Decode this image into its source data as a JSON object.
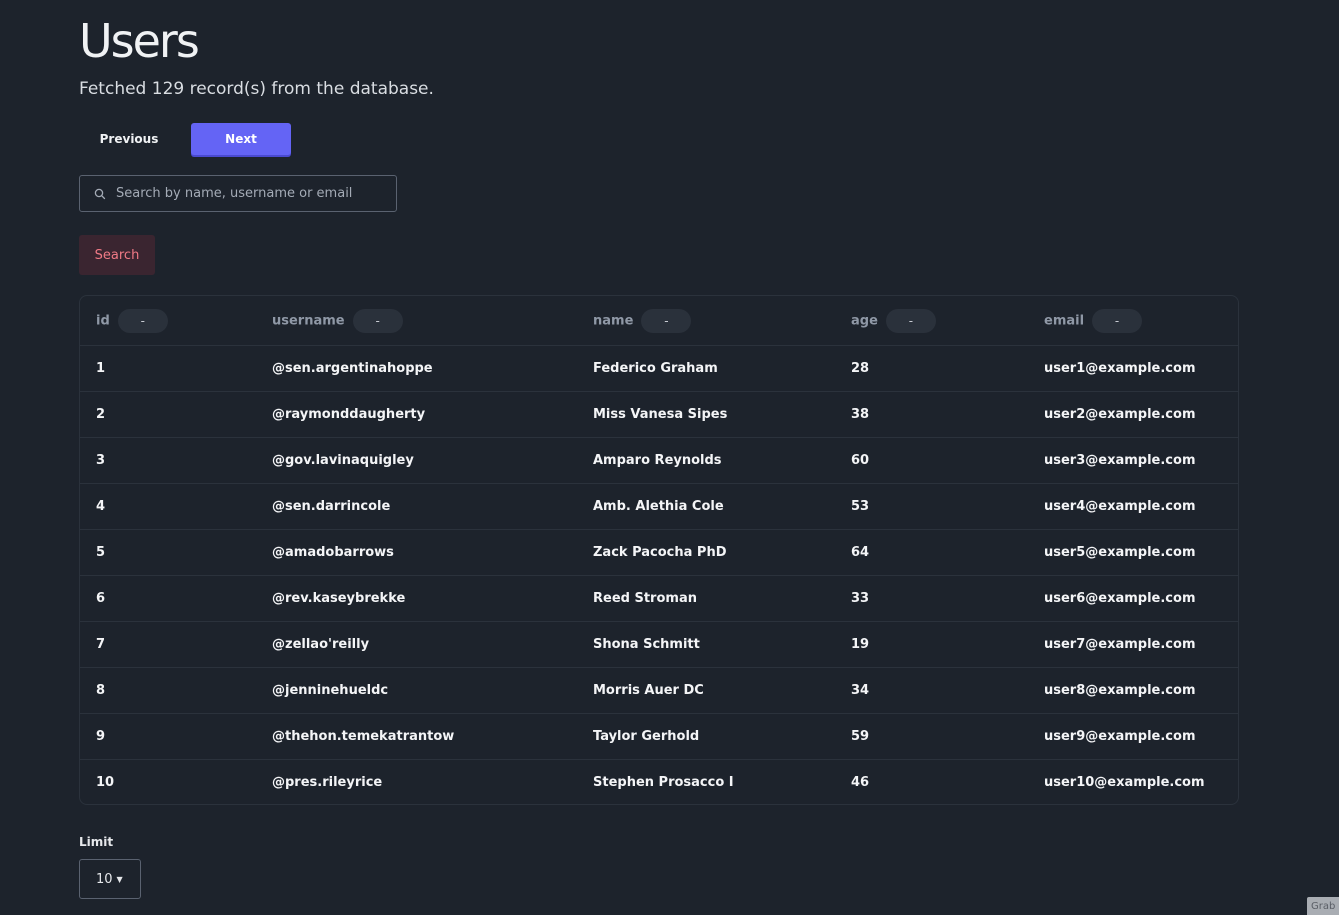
{
  "page": {
    "title": "Users",
    "subtitle": "Fetched 129 record(s) from the database."
  },
  "pagination": {
    "previous_label": "Previous",
    "next_label": "Next"
  },
  "search": {
    "placeholder": "Search by name, username or email",
    "value": "",
    "button_label": "Search"
  },
  "table": {
    "columns": [
      {
        "key": "id",
        "label": "id",
        "sort": "-"
      },
      {
        "key": "username",
        "label": "username",
        "sort": "-"
      },
      {
        "key": "name",
        "label": "name",
        "sort": "-"
      },
      {
        "key": "age",
        "label": "age",
        "sort": "-"
      },
      {
        "key": "email",
        "label": "email",
        "sort": "-"
      }
    ],
    "rows": [
      {
        "id": "1",
        "username": "@sen.argentinahoppe",
        "name": "Federico Graham",
        "age": "28",
        "email": "user1@example.com"
      },
      {
        "id": "2",
        "username": "@raymonddaugherty",
        "name": "Miss Vanesa Sipes",
        "age": "38",
        "email": "user2@example.com"
      },
      {
        "id": "3",
        "username": "@gov.lavinaquigley",
        "name": "Amparo Reynolds",
        "age": "60",
        "email": "user3@example.com"
      },
      {
        "id": "4",
        "username": "@sen.darrincole",
        "name": "Amb. Alethia Cole",
        "age": "53",
        "email": "user4@example.com"
      },
      {
        "id": "5",
        "username": "@amadobarrows",
        "name": "Zack Pacocha PhD",
        "age": "64",
        "email": "user5@example.com"
      },
      {
        "id": "6",
        "username": "@rev.kaseybrekke",
        "name": "Reed Stroman",
        "age": "33",
        "email": "user6@example.com"
      },
      {
        "id": "7",
        "username": "@zellao'reilly",
        "name": "Shona Schmitt",
        "age": "19",
        "email": "user7@example.com"
      },
      {
        "id": "8",
        "username": "@jenninehueldc",
        "name": "Morris Auer DC",
        "age": "34",
        "email": "user8@example.com"
      },
      {
        "id": "9",
        "username": "@thehon.temekatrantow",
        "name": "Taylor Gerhold",
        "age": "59",
        "email": "user9@example.com"
      },
      {
        "id": "10",
        "username": "@pres.rileyrice",
        "name": "Stephen Prosacco I",
        "age": "46",
        "email": "user10@example.com"
      }
    ]
  },
  "limit": {
    "label": "Limit",
    "value": "10"
  },
  "corner_tab": {
    "label": "Grab"
  },
  "colors": {
    "background": "#1d232c",
    "accent": "#6464f5",
    "danger_text": "#f07a86"
  },
  "icons": {
    "search": "search-icon",
    "caret": "caret-down-icon"
  }
}
